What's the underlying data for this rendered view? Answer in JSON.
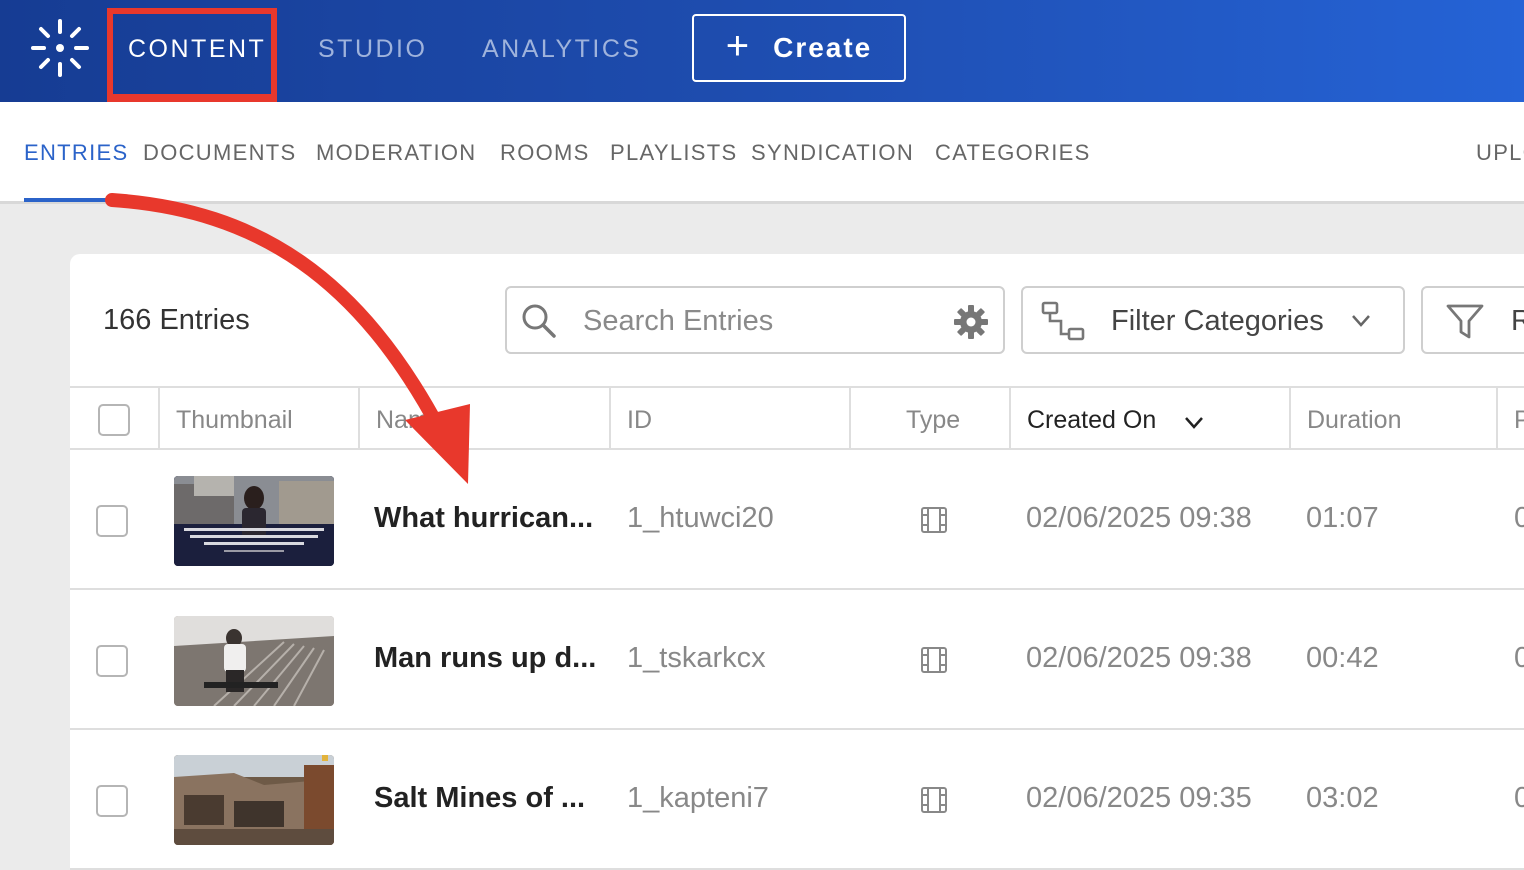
{
  "header": {
    "logo_icon": "kaltura-logo-icon",
    "nav": [
      {
        "label": "CONTENT",
        "active": true
      },
      {
        "label": "STUDIO",
        "active": false
      },
      {
        "label": "ANALYTICS",
        "active": false
      }
    ],
    "create_label": "Create"
  },
  "subnav": {
    "items": [
      "ENTRIES",
      "DOCUMENTS",
      "MODERATION",
      "ROOMS",
      "PLAYLISTS",
      "SYNDICATION",
      "CATEGORIES",
      "UPLO"
    ],
    "active": "ENTRIES"
  },
  "toolbar": {
    "entries_count": "166 Entries",
    "search_placeholder": "Search Entries",
    "filter_categories": "Filter Categories",
    "refine_label": "R"
  },
  "table": {
    "columns": [
      "Thumbnail",
      "Name",
      "ID",
      "Type",
      "Created On",
      "Duration",
      "P"
    ],
    "sorted_column": "Created On",
    "rows": [
      {
        "name": "What hurrican...",
        "id": "1_htuwci20",
        "type": "video",
        "created": "02/06/2025 09:38",
        "duration": "01:07",
        "extra": "0"
      },
      {
        "name": "Man runs up d...",
        "id": "1_tskarkcx",
        "type": "video",
        "created": "02/06/2025 09:38",
        "duration": "00:42",
        "extra": "0"
      },
      {
        "name": "Salt Mines of ...",
        "id": "1_kapteni7",
        "type": "video",
        "created": "02/06/2025 09:35",
        "duration": "03:02",
        "extra": "0"
      }
    ]
  },
  "colors": {
    "topbar_start": "#163c93",
    "topbar_end": "#2563d6",
    "accent": "#2b63c9",
    "annotation_red": "#e8382c"
  }
}
